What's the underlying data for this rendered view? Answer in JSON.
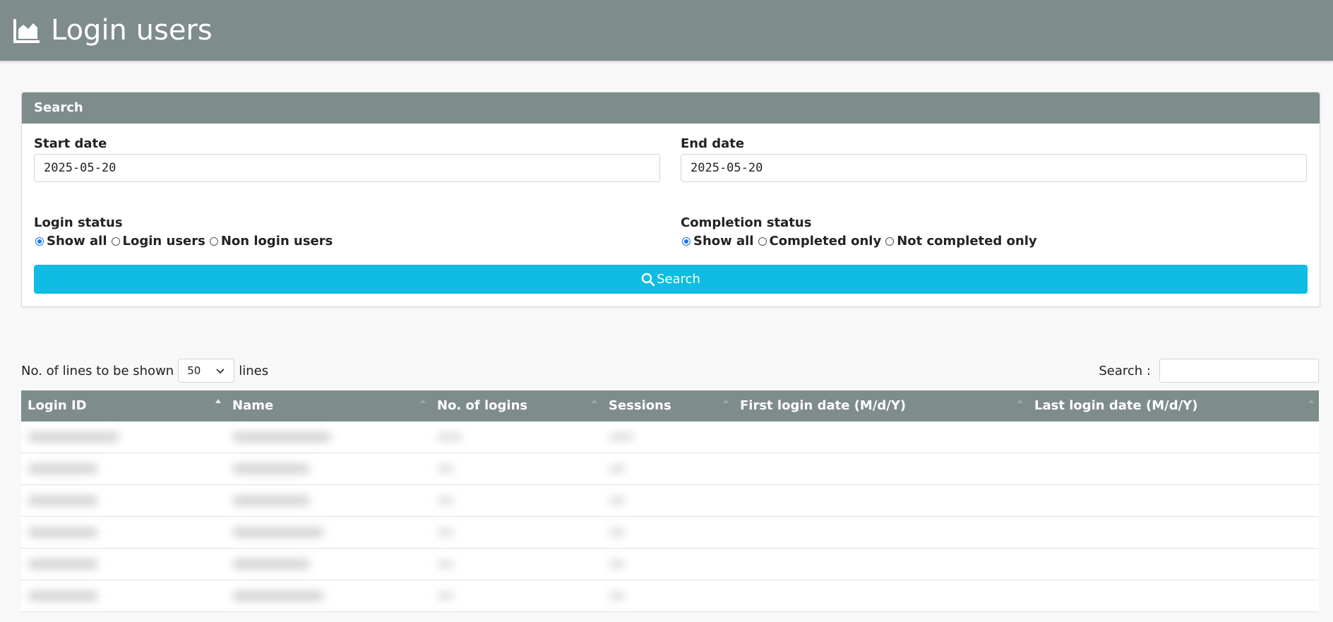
{
  "header": {
    "title": "Login users",
    "icon": "area-chart-icon"
  },
  "search_panel": {
    "title": "Search",
    "start_date": {
      "label": "Start date",
      "value": "2025-05-20"
    },
    "end_date": {
      "label": "End date",
      "value": "2025-05-20"
    },
    "login_status": {
      "label": "Login status",
      "options": [
        "Show all",
        "Login users",
        "Non login users"
      ],
      "selected": "Show all"
    },
    "completion_status": {
      "label": "Completion status",
      "options": [
        "Show all",
        "Completed only",
        "Not completed only"
      ],
      "selected": "Show all"
    },
    "button_label": "Search"
  },
  "table_controls": {
    "lines_prefix": "No. of lines to be shown",
    "lines_value": "50",
    "lines_suffix": "lines",
    "search_label": "Search :"
  },
  "table": {
    "columns": [
      "Login ID",
      "Name",
      "No. of logins",
      "Sessions",
      "First login date (M/d/Y)",
      "Last login date (M/d/Y)"
    ],
    "rows_count_visible": 6
  },
  "colors": {
    "header": "#7f8c8c",
    "primary_button": "#0ebce4",
    "radio_checked": "#1a73e8"
  }
}
